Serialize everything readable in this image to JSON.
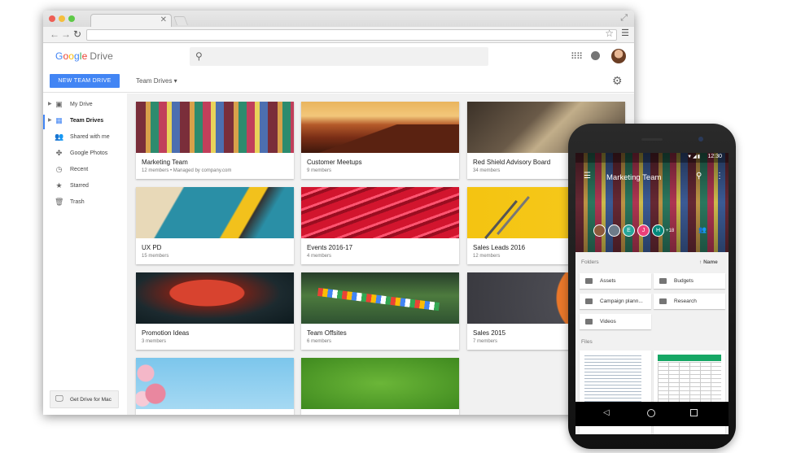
{
  "browser": {
    "traffic_colors": [
      "#ee5e55",
      "#f5be3d",
      "#5ec947"
    ]
  },
  "header": {
    "logo_g": "G",
    "logo_o1": "o",
    "logo_o2": "o",
    "logo_g2": "g",
    "logo_l": "l",
    "logo_e": "e",
    "logo_product": "Drive",
    "search_placeholder": ""
  },
  "toolbar": {
    "new_button_label": "NEW TEAM DRIVE",
    "section_label": "Team Drives"
  },
  "sidebar": {
    "items": [
      {
        "label": "My Drive",
        "icon": "my-drive-icon",
        "glyph": "▣"
      },
      {
        "label": "Team Drives",
        "icon": "team-drives-icon",
        "glyph": "▦"
      },
      {
        "label": "Shared with me",
        "icon": "shared-icon",
        "glyph": "👥"
      },
      {
        "label": "Google Photos",
        "icon": "photos-icon",
        "glyph": "✤"
      },
      {
        "label": "Recent",
        "icon": "clock-icon",
        "glyph": "◷"
      },
      {
        "label": "Starred",
        "icon": "star-icon",
        "glyph": "★"
      },
      {
        "label": "Trash",
        "icon": "trash-icon",
        "glyph": "🗑"
      }
    ],
    "get_drive_label": "Get Drive for Mac"
  },
  "team_drives": [
    {
      "title": "Marketing Team",
      "subtitle": "12 members  •  Managed by company.com"
    },
    {
      "title": "Customer Meetups",
      "subtitle": "9 members"
    },
    {
      "title": "Red Shield Advisory Board",
      "subtitle": "34 members"
    },
    {
      "title": "UX PD",
      "subtitle": "15 members"
    },
    {
      "title": "Events 2016-17",
      "subtitle": "4 members"
    },
    {
      "title": "Sales Leads 2016",
      "subtitle": "12 members"
    },
    {
      "title": "Promotion Ideas",
      "subtitle": "3 members"
    },
    {
      "title": "Team Offsites",
      "subtitle": "6 members"
    },
    {
      "title": "Sales 2015",
      "subtitle": "7 members"
    },
    {
      "title": "",
      "subtitle": ""
    },
    {
      "title": "",
      "subtitle": ""
    }
  ],
  "phone": {
    "time": "12:30",
    "title": "Marketing Team",
    "members": [
      {
        "initial": "",
        "color": "#8d5a3c"
      },
      {
        "initial": "",
        "color": "#6d7b8a"
      },
      {
        "initial": "E",
        "color": "#26a69a"
      },
      {
        "initial": "J",
        "color": "#ec407a"
      },
      {
        "initial": "H",
        "color": "#00897b"
      }
    ],
    "more_members": "+18",
    "folders_label": "Folders",
    "sort_label": "Name",
    "folders": [
      "Assets",
      "Budgets",
      "Campaign plann...",
      "Research",
      "Videos"
    ],
    "files_label": "Files"
  }
}
